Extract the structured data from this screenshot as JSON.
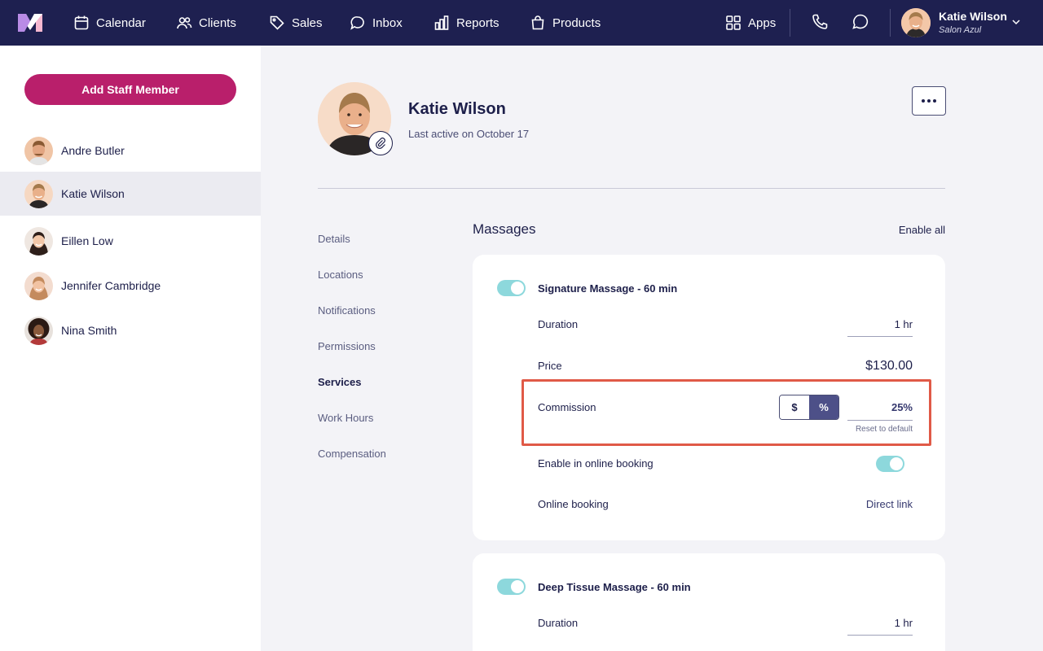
{
  "nav": {
    "items": [
      {
        "label": "Calendar",
        "icon": "calendar-icon"
      },
      {
        "label": "Clients",
        "icon": "users-icon"
      },
      {
        "label": "Sales",
        "icon": "tag-icon"
      },
      {
        "label": "Inbox",
        "icon": "chat-icon"
      },
      {
        "label": "Reports",
        "icon": "bar-chart-icon"
      },
      {
        "label": "Products",
        "icon": "bag-icon"
      }
    ],
    "apps_label": "Apps",
    "user": {
      "name": "Katie Wilson",
      "salon": "Salon Azul"
    }
  },
  "sidebar": {
    "add_button": "Add Staff Member",
    "staff": [
      {
        "name": "Andre Butler",
        "active": false
      },
      {
        "name": "Katie Wilson",
        "active": true
      },
      {
        "name": "Eillen Low",
        "active": false
      },
      {
        "name": "Jennifer Cambridge",
        "active": false
      },
      {
        "name": "Nina Smith",
        "active": false
      }
    ]
  },
  "profile": {
    "name": "Katie Wilson",
    "last_active": "Last active on October 17"
  },
  "subnav": [
    "Details",
    "Locations",
    "Notifications",
    "Permissions",
    "Services",
    "Work Hours",
    "Compensation"
  ],
  "subnav_active": "Services",
  "section": {
    "title": "Massages",
    "enable_all": "Enable all"
  },
  "services": [
    {
      "title": "Signature Massage - 60 min",
      "enabled": true,
      "duration_label": "Duration",
      "duration_value": "1 hr",
      "price_label": "Price",
      "price_value": "$130.00",
      "commission_label": "Commission",
      "commission_dollar": "$",
      "commission_percent": "%",
      "commission_value": "25%",
      "reset_label": "Reset to default",
      "online_label": "Enable in online booking",
      "online_enabled": true,
      "booking_label": "Online booking",
      "booking_link": "Direct link"
    },
    {
      "title": "Deep Tissue Massage - 60 min",
      "enabled": true,
      "duration_label": "Duration",
      "duration_value": "1 hr"
    }
  ],
  "colors": {
    "nav_bg": "#1e2050",
    "brand_button": "#b91f6b",
    "toggle_on": "#8dd8dc",
    "segment_active": "#4d5088",
    "highlight": "#e05a47"
  }
}
